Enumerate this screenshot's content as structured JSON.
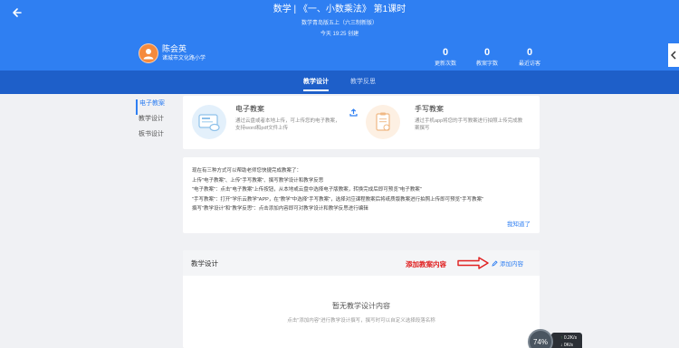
{
  "header": {
    "title": "数学 | 《一、小数乘法》 第1课时",
    "subtitle": "数学青岛版五上（六三制新版）",
    "created": "今天 19:25 创建",
    "user": {
      "name": "陈会英",
      "school": "诸城市文化路小学"
    },
    "stats": [
      {
        "num": "0",
        "label": "更新次数"
      },
      {
        "num": "0",
        "label": "教案字数"
      },
      {
        "num": "0",
        "label": "最近访客"
      }
    ]
  },
  "tabs": [
    {
      "label": "教学设计",
      "active": true
    },
    {
      "label": "教学反思",
      "active": false
    }
  ],
  "leftnav": [
    {
      "label": "电子教案",
      "active": true
    },
    {
      "label": "教学设计",
      "active": false
    },
    {
      "label": "板书设计",
      "active": false
    }
  ],
  "types": {
    "electronic": {
      "title": "电子教案",
      "desc_line1": "通过云盘或者本地上传，可上传您的电子教案，",
      "desc_line2": "支持word和pdf文件上传"
    },
    "handwritten": {
      "title": "手写教案",
      "desc_line1": "通过手机app将您的手写教案进行拍照上传完成教",
      "desc_line2": "案撰写"
    }
  },
  "info": {
    "lines": [
      "现在有三种方式可以帮助老师您快捷完成教案了：",
      "上传\"电子教案\"、上传\"手写教案\"、撰写教学设计和教学反思",
      "\"电子教案\"：点击\"电子教案\"上传按钮，从本地或云盘中选择电子版教案，转换完成后即可预览\"电子教案\"",
      "\"手写教案\"：打开\"学乐云教学\"APP，在\"教学\"中选择\"手写教案\"，选择对应课程教案后将纸质版教案进行拍照上传即可预览\"手写教案\"",
      "撰写\"教学设计\"和\"教学反思\"：点击添加内容即可对教学设计和教学反思进行编辑"
    ],
    "got_it": "我知道了"
  },
  "design": {
    "title": "教学设计",
    "annotation": "添加教案内容",
    "add_label": "添加内容",
    "empty_title": "暂无教学设计内容",
    "empty_desc": "点击\"添加内容\"进行教学设计撰写，撰写时可以自定义选择段落名称"
  },
  "network": {
    "percent": "74%",
    "up": "0.2K/s",
    "down": "0K/s"
  },
  "colors": {
    "primary": "#2f7ff2",
    "tabbar": "#1e5fc9",
    "annotation": "#e02020"
  }
}
